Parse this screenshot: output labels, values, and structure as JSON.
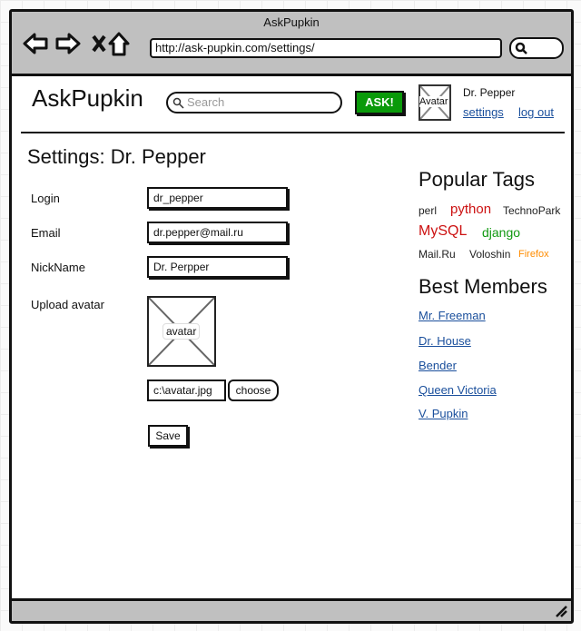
{
  "browser": {
    "title": "AskPupkin",
    "url": "http://ask-pupkin.com/settings/"
  },
  "header": {
    "logo": "AskPupkin",
    "search_placeholder": "Search",
    "ask_label": "ASK!",
    "avatar_label": "Avatar",
    "username": "Dr. Pepper",
    "settings_link": "settings",
    "logout_link": "log out"
  },
  "settings": {
    "title": "Settings: Dr. Pepper",
    "fields": [
      {
        "label": "Login",
        "value": "dr_pepper"
      },
      {
        "label": "Email",
        "value": "dr.pepper@mail.ru"
      },
      {
        "label": "NickName",
        "value": "Dr. Perpper"
      }
    ],
    "upload_label": "Upload avatar",
    "avatar_placeholder": "avatar",
    "file_value": "c:\\avatar.jpg",
    "choose_label": "choose",
    "save_label": "Save"
  },
  "sidebar": {
    "tags_title": "Popular Tags",
    "tags": [
      {
        "label": "perl",
        "color": "#222222"
      },
      {
        "label": "python",
        "color": "#cc1111"
      },
      {
        "label": "TechnoPark",
        "color": "#222222"
      },
      {
        "label": "MySQL",
        "color": "#cc1111"
      },
      {
        "label": "django",
        "color": "#119911"
      },
      {
        "label": "Mail.Ru",
        "color": "#222222"
      },
      {
        "label": "Voloshin",
        "color": "#222222"
      },
      {
        "label": "Firefox",
        "color": "#ff8c00"
      }
    ],
    "members_title": "Best Members",
    "members": [
      "Mr. Freeman",
      "Dr. House",
      "Bender",
      "Queen Victoria",
      "V. Pupkin"
    ]
  }
}
